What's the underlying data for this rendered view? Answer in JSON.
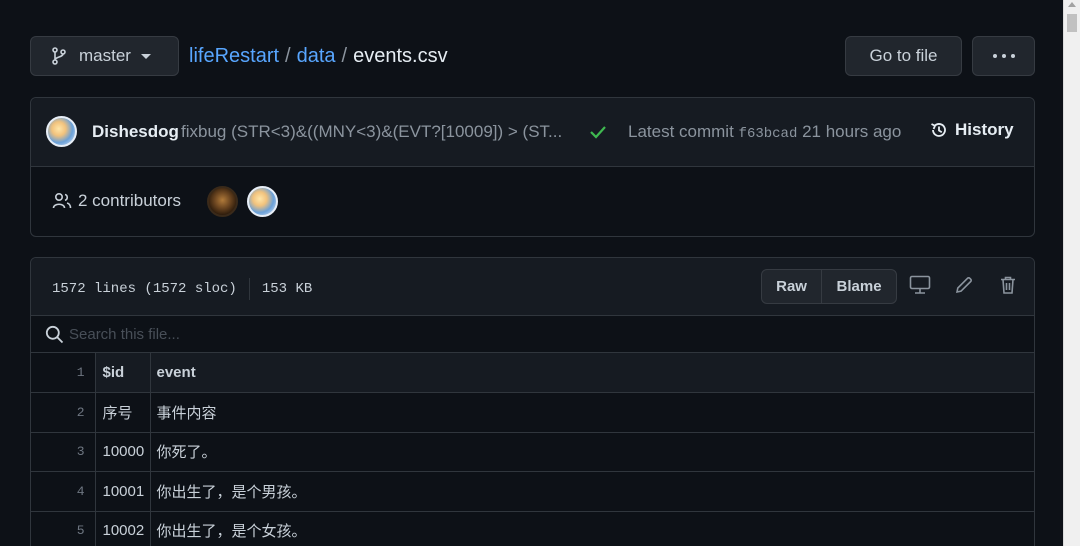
{
  "branch": {
    "name": "master"
  },
  "breadcrumb": {
    "repo": "lifeRestart",
    "sep1": "/",
    "folder": "data",
    "sep2": "/",
    "file": "events.csv"
  },
  "toolbar": {
    "goto_label": "Go to file"
  },
  "commit": {
    "author": "Dishesdog",
    "message": "fixbug (STR<3)&((MNY<3)&(EVT?[10009]) > (ST...",
    "latest_label": "Latest commit",
    "sha": "f63bcad",
    "time": "21 hours ago",
    "history_label": "History"
  },
  "contributors": {
    "label": "2 contributors"
  },
  "file": {
    "lines": "1572 lines (1572 sloc)",
    "size": "153 KB",
    "raw_label": "Raw",
    "blame_label": "Blame"
  },
  "search": {
    "placeholder": "Search this file..."
  },
  "table": {
    "rows": [
      {
        "ln": "1",
        "c1": "$id",
        "c2": "event"
      },
      {
        "ln": "2",
        "c1": "序号",
        "c2": "事件内容"
      },
      {
        "ln": "3",
        "c1": "10000",
        "c2": "你死了。"
      },
      {
        "ln": "4",
        "c1": "10001",
        "c2": "你出生了，是个男孩。"
      },
      {
        "ln": "5",
        "c1": "10002",
        "c2": "你出生了，是个女孩。"
      }
    ]
  }
}
